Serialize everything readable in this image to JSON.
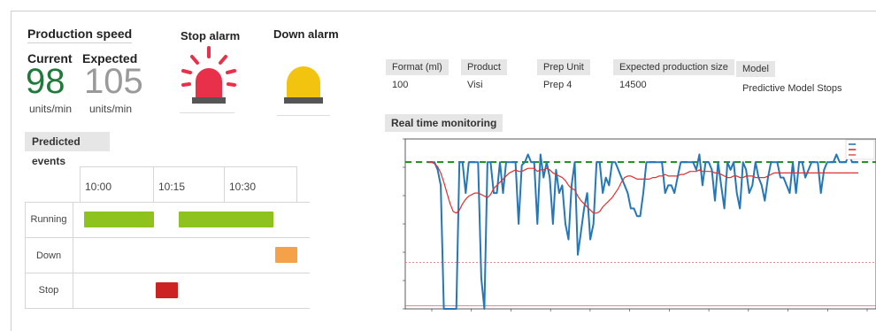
{
  "production": {
    "title": "Production speed",
    "current_label": "Current",
    "current_value": "98",
    "current_unit": "units/min",
    "expected_label": "Expected",
    "expected_value": "105",
    "expected_unit": "units/min"
  },
  "alarms": {
    "stop_title": "Stop alarm",
    "down_title": "Down alarm",
    "stop_color": "#e8304a",
    "down_color": "#f2c40f"
  },
  "predicted_events": {
    "title": "Predicted events",
    "times": [
      "10:00",
      "10:15",
      "10:30"
    ],
    "rows": [
      "Running",
      "Down",
      "Stop"
    ],
    "colors": {
      "running": "#8dc21f",
      "down": "#f4a14a",
      "stop": "#cc2222"
    }
  },
  "info": {
    "headers": [
      "Format (ml)",
      "Product",
      "Prep Unit",
      "Expected production size",
      "Model"
    ],
    "values": [
      "100",
      "Visi",
      "Prep 4",
      "14500",
      "Predictive Model Stops"
    ]
  },
  "monitoring": {
    "title": "Real time monitoring"
  },
  "chart_data": {
    "type": "line",
    "series": [
      {
        "color": "#2577b8",
        "values": [
          95,
          95,
          95,
          90,
          80,
          0,
          0,
          0,
          0,
          0,
          95,
          95,
          75,
          95,
          95,
          95,
          95,
          20,
          0,
          95,
          95,
          75,
          75,
          95,
          75,
          95,
          95,
          95,
          95,
          55,
          93,
          95,
          100,
          95,
          95,
          55,
          100,
          85,
          95,
          85,
          55,
          90,
          75,
          80,
          55,
          45,
          80,
          95,
          35,
          50,
          65,
          75,
          45,
          55,
          95,
          95,
          75,
          85,
          80,
          95,
          95,
          90,
          85,
          80,
          75,
          65,
          65,
          60,
          60,
          75,
          95,
          95,
          95,
          95,
          95,
          95,
          75,
          80,
          80,
          75,
          85,
          95,
          95,
          95,
          95,
          95,
          90,
          100,
          80,
          95,
          95,
          90,
          70,
          95,
          80,
          65,
          95,
          90,
          95,
          75,
          65,
          95,
          90,
          75,
          80,
          95,
          85,
          80,
          70,
          85,
          95,
          95,
          95,
          85,
          85,
          80,
          75,
          95,
          75,
          95,
          95,
          85,
          90,
          95,
          95,
          95,
          75,
          90,
          95,
          95,
          95,
          100,
          95,
          95,
          95,
          100,
          95,
          95,
          95
        ]
      },
      {
        "color": "#e03030",
        "values": [
          95,
          95,
          94,
          92,
          88,
          82,
          75,
          68,
          63,
          62,
          64,
          68,
          71,
          73,
          74,
          75,
          75,
          74,
          73,
          72,
          74,
          78,
          80,
          82,
          84,
          86,
          88,
          89,
          90,
          89,
          89,
          90,
          91,
          91,
          91,
          89,
          90,
          90,
          91,
          90,
          88,
          87,
          86,
          85,
          83,
          80,
          78,
          77,
          73,
          70,
          68,
          66,
          64,
          62,
          62,
          63,
          66,
          68,
          70,
          72,
          75,
          78,
          82,
          85,
          86,
          86,
          85,
          84,
          84,
          84,
          84,
          84,
          85,
          85,
          86,
          86,
          87,
          86,
          86,
          86,
          86,
          87,
          87,
          88,
          89,
          89,
          89,
          90,
          89,
          89,
          89,
          89,
          88,
          88,
          87,
          86,
          85,
          85,
          86,
          86,
          85,
          85,
          86,
          86,
          86,
          85,
          85,
          85,
          85,
          86,
          87,
          88,
          88,
          88,
          88,
          88,
          88,
          88,
          88,
          88,
          88,
          88,
          88,
          88,
          88,
          88,
          88,
          88,
          88,
          88,
          88,
          88,
          88,
          88,
          88,
          88,
          88,
          88,
          88
        ]
      }
    ],
    "ylim": [
      0,
      110
    ],
    "reference_lines": [
      {
        "value": 95,
        "color": "#1e8a1e",
        "style": "dashed"
      },
      {
        "value": 30,
        "color": "#e06060",
        "style": "dotted"
      },
      {
        "value": 2,
        "color": "#e06060",
        "style": "solid"
      }
    ],
    "legend_position": "top-right",
    "grid": false
  }
}
